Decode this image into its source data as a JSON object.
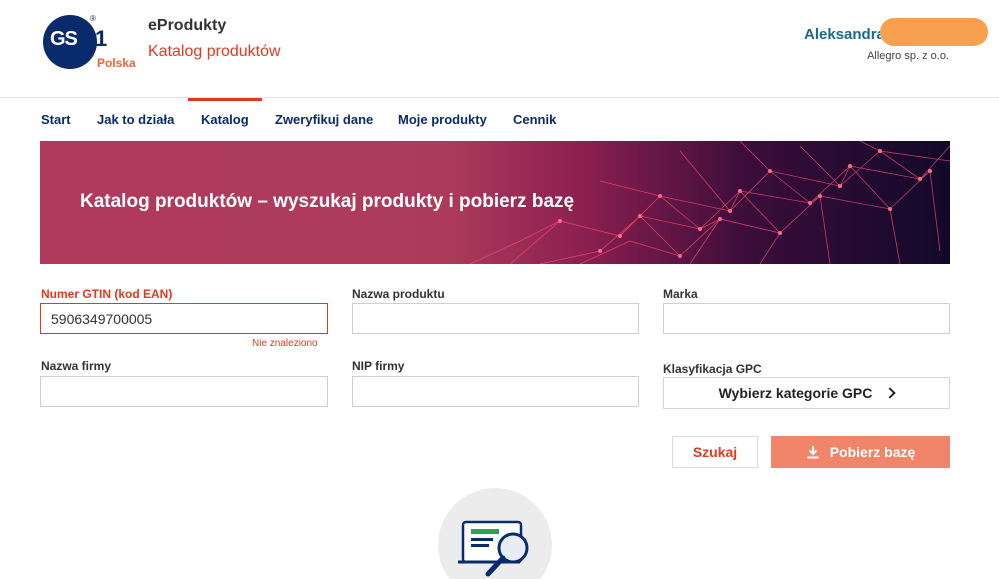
{
  "header": {
    "logo_text": "GS",
    "logo_one": "1",
    "logo_reg": "®",
    "logo_country": "Polska",
    "app_name": "eProdukty",
    "app_subtitle": "Katalog produktów",
    "user_name": "Aleksandra",
    "company": "Allegro sp. z o.o."
  },
  "nav": {
    "items": [
      {
        "label": "Start"
      },
      {
        "label": "Jak to działa"
      },
      {
        "label": "Katalog",
        "active": true
      },
      {
        "label": "Zweryfikuj dane"
      },
      {
        "label": "Moje produkty"
      },
      {
        "label": "Cennik"
      }
    ]
  },
  "banner": {
    "title": "Katalog produktów – wyszukaj produkty i pobierz bazę"
  },
  "form": {
    "gtin_label": "Numer GTIN (kod EAN)",
    "gtin_value": "5906349700005",
    "gtin_error": "Nie znaleziono",
    "product_name_label": "Nazwa produktu",
    "brand_label": "Marka",
    "company_name_label": "Nazwa firmy",
    "nip_label": "NIP firmy",
    "gpc_label": "Klasyfikacja GPC",
    "gpc_button": "Wybierz kategorie GPC",
    "search_button": "Szukaj",
    "download_button": "Pobierz bazę"
  },
  "colors": {
    "accent": "#e03a1e",
    "navy": "#0a2b6b",
    "download": "#f08569"
  }
}
